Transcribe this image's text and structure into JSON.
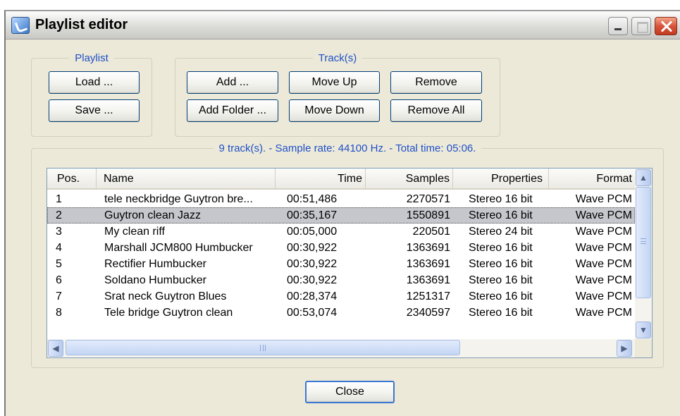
{
  "window": {
    "title": "Playlist editor",
    "app_icon": "playlist-app-icon",
    "controls": [
      "minimize-icon",
      "maximize-icon",
      "close-icon"
    ]
  },
  "playlist_group": {
    "legend": "Playlist",
    "load_label": "Load ...",
    "save_label": "Save ..."
  },
  "tracks_group": {
    "legend": "Track(s)",
    "add_label": "Add ...",
    "add_folder_label": "Add Folder ...",
    "move_up_label": "Move Up",
    "move_down_label": "Move Down",
    "remove_label": "Remove",
    "remove_all_label": "Remove All"
  },
  "summary": {
    "text": "9 track(s). - Sample rate: 44100 Hz. - Total time:   05:06."
  },
  "table": {
    "columns": [
      "Pos.",
      "Name",
      "Time",
      "Samples",
      "Properties",
      "Format"
    ],
    "selected_row_index": 1,
    "rows": [
      {
        "pos": "1",
        "name": "tele neckbridge Guytron bre...",
        "time": "00:51,486",
        "samples": "2270571",
        "properties": "Stereo 16 bit",
        "format": "Wave PCM"
      },
      {
        "pos": "2",
        "name": "Guytron clean Jazz",
        "time": "00:35,167",
        "samples": "1550891",
        "properties": "Stereo 16 bit",
        "format": "Wave PCM"
      },
      {
        "pos": "3",
        "name": "My clean riff",
        "time": "00:05,000",
        "samples": "220501",
        "properties": "Stereo 24 bit",
        "format": "Wave PCM"
      },
      {
        "pos": "4",
        "name": "Marshall JCM800 Humbucker",
        "time": "00:30,922",
        "samples": "1363691",
        "properties": "Stereo 16 bit",
        "format": "Wave PCM"
      },
      {
        "pos": "5",
        "name": "Rectifier Humbucker",
        "time": "00:30,922",
        "samples": "1363691",
        "properties": "Stereo 16 bit",
        "format": "Wave PCM"
      },
      {
        "pos": "6",
        "name": "Soldano Humbucker",
        "time": "00:30,922",
        "samples": "1363691",
        "properties": "Stereo 16 bit",
        "format": "Wave PCM"
      },
      {
        "pos": "7",
        "name": "Srat neck Guytron Blues",
        "time": "00:28,374",
        "samples": "1251317",
        "properties": "Stereo 16 bit",
        "format": "Wave PCM"
      },
      {
        "pos": "8",
        "name": "Tele bridge Guytron clean",
        "time": "00:53,074",
        "samples": "2340597",
        "properties": "Stereo 16 bit",
        "format": "Wave PCM"
      }
    ]
  },
  "close_button": {
    "label": "Close"
  },
  "colors": {
    "group_legend": "#1f50c8",
    "window_bg": "#ece9d8",
    "selected_row": "#c6c7cd",
    "button_border": "#003c74"
  }
}
